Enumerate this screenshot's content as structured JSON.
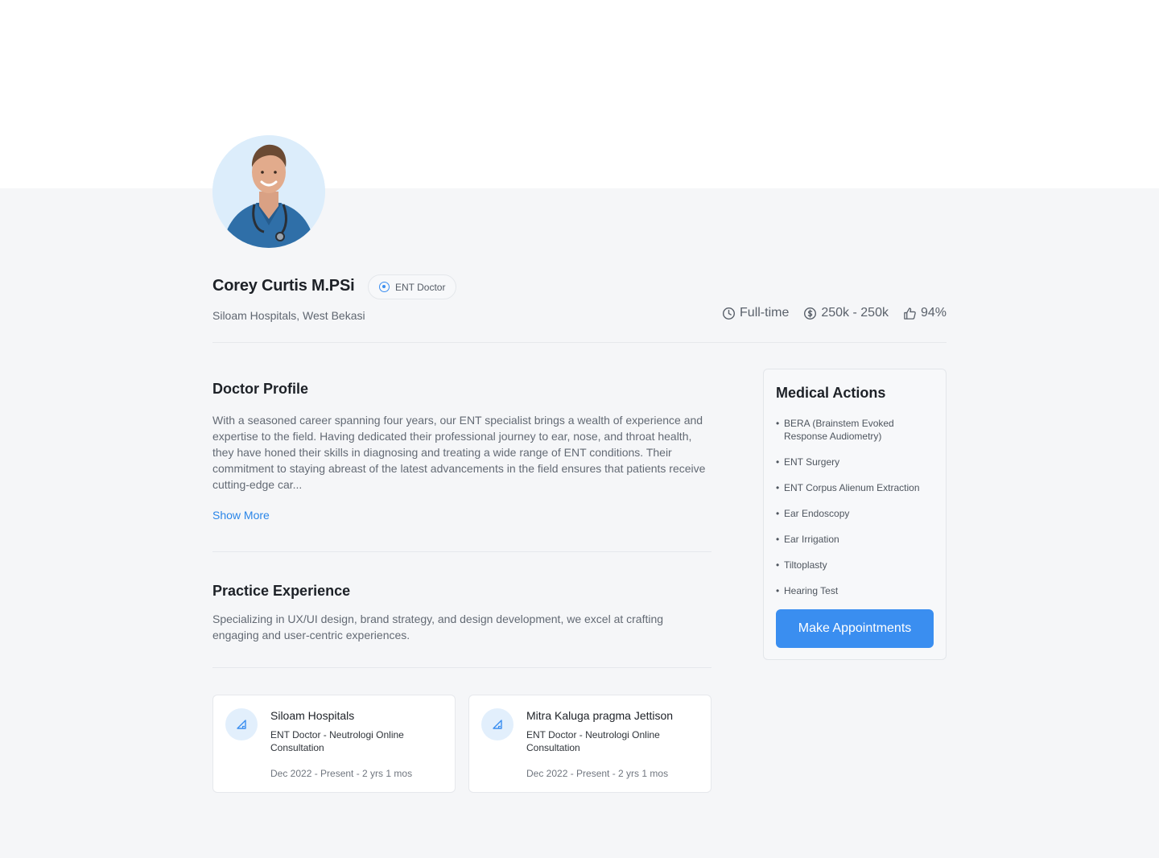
{
  "profile": {
    "name": "Corey Curtis M.PSi",
    "specialty_badge": "ENT Doctor",
    "location": "Siloam Hospitals, West Bekasi"
  },
  "stats": {
    "employment": "Full-time",
    "fee_range": "250k - 250k",
    "rating": "94%"
  },
  "doctor_profile": {
    "title": "Doctor Profile",
    "text": "With a seasoned career spanning four years, our ENT specialist brings a wealth of experience and expertise to the field. Having dedicated their professional journey to ear, nose, and throat health, they have honed their skills in diagnosing and treating a wide range of ENT conditions. Their commitment to staying abreast of the latest advancements in the field ensures that patients receive cutting-edge car...",
    "show_more": "Show More"
  },
  "practice_experience": {
    "title": "Practice Experience",
    "text": "Specializing in UX/UI design, brand strategy, and design development, we excel at crafting engaging and user-centric experiences.",
    "items": [
      {
        "organization": "Siloam Hospitals",
        "role": "ENT Doctor - Neutrologi Online Consultation",
        "period": "Dec 2022 - Present  - 2 yrs 1 mos"
      },
      {
        "organization": "Mitra Kaluga pragma Jettison",
        "role": "ENT Doctor - Neutrologi Online Consultation",
        "period": "Dec 2022 - Present  - 2 yrs 1 mos"
      }
    ]
  },
  "medical_actions": {
    "title": "Medical Actions",
    "items": [
      "BERA (Brainstem Evoked Response Audiometry)",
      "ENT Surgery",
      "ENT Corpus Alienum Extraction",
      "Ear Endoscopy",
      "Ear Irrigation",
      "Tiltoplasty",
      "Hearing Test"
    ],
    "button_label": "Make Appointments"
  },
  "colors": {
    "accent": "#3a8ef0",
    "link": "#2b86e8",
    "band_background": "#f5f6f8",
    "icon_bubble": "#e2effc"
  },
  "icons": {
    "badge": "target-icon",
    "employment": "clock-icon",
    "fee": "dollar-circle-icon",
    "rating": "thumbs-up-icon",
    "experience": "triangle-ruler-icon"
  }
}
